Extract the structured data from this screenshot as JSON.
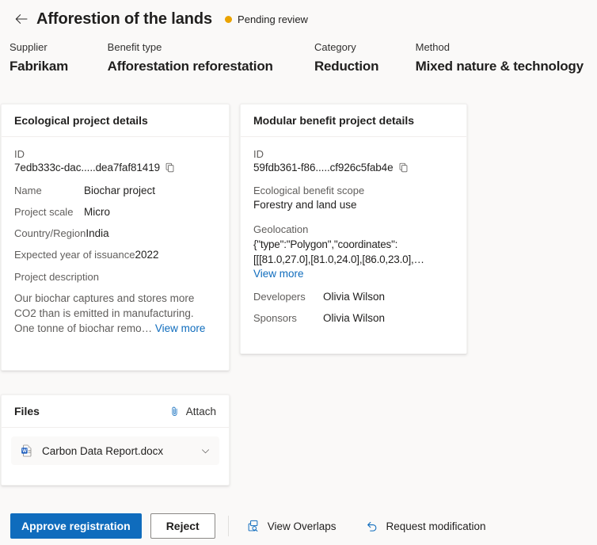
{
  "header": {
    "back_icon": "arrow-left-icon",
    "title": "Afforestion of the lands",
    "status_text": "Pending review",
    "status_color": "#eaa300",
    "meta": [
      {
        "label": "Supplier",
        "value": "Fabrikam"
      },
      {
        "label": "Benefit type",
        "value": "Afforestation reforestation"
      },
      {
        "label": "Category",
        "value": "Reduction"
      },
      {
        "label": "Method",
        "value": "Mixed nature & technology"
      }
    ]
  },
  "ecological_card": {
    "title": "Ecological project details",
    "id_label": "ID",
    "id_value": "7edb333c-dac.....dea7faf81419",
    "copy_icon": "copy-icon",
    "fields": [
      {
        "label": "Name",
        "value": "Biochar project"
      },
      {
        "label": "Project scale",
        "value": "Micro"
      },
      {
        "label": "Country/Region",
        "value": "India"
      },
      {
        "label": "Expected year of issuance",
        "value": "2022"
      }
    ],
    "description_label": "Project description",
    "description_text": "Our biochar captures and stores more CO2 than is emitted in manufacturing. One tonne of biochar remo…",
    "view_more": "View more"
  },
  "modular_card": {
    "title": "Modular benefit project details",
    "id_label": "ID",
    "id_value": "59fdb361-f86.....cf926c5fab4e",
    "copy_icon": "copy-icon",
    "scope_label": "Ecological benefit scope",
    "scope_value": "Forestry and land use",
    "geolocation_label": "Geolocation",
    "geolocation_value": "{\"type\":\"Polygon\",\"coordinates\": [[[81.0,27.0],[81.0,24.0],[86.0,23.0],…",
    "view_more": "View more",
    "people": [
      {
        "label": "Developers",
        "value": "Olivia Wilson"
      },
      {
        "label": "Sponsors",
        "value": "Olivia Wilson"
      }
    ]
  },
  "files_card": {
    "title": "Files",
    "attach_label": "Attach",
    "attach_icon": "paperclip-icon",
    "file": {
      "icon": "word-document-icon",
      "name": "Carbon Data Report.docx",
      "chevron": "chevron-down-icon"
    }
  },
  "footer": {
    "approve_label": "Approve registration",
    "reject_label": "Reject",
    "commands": [
      {
        "label": "View Overlaps",
        "icon": "view-overlaps-icon"
      },
      {
        "label": "Request modification",
        "icon": "undo-arrow-icon"
      }
    ]
  }
}
